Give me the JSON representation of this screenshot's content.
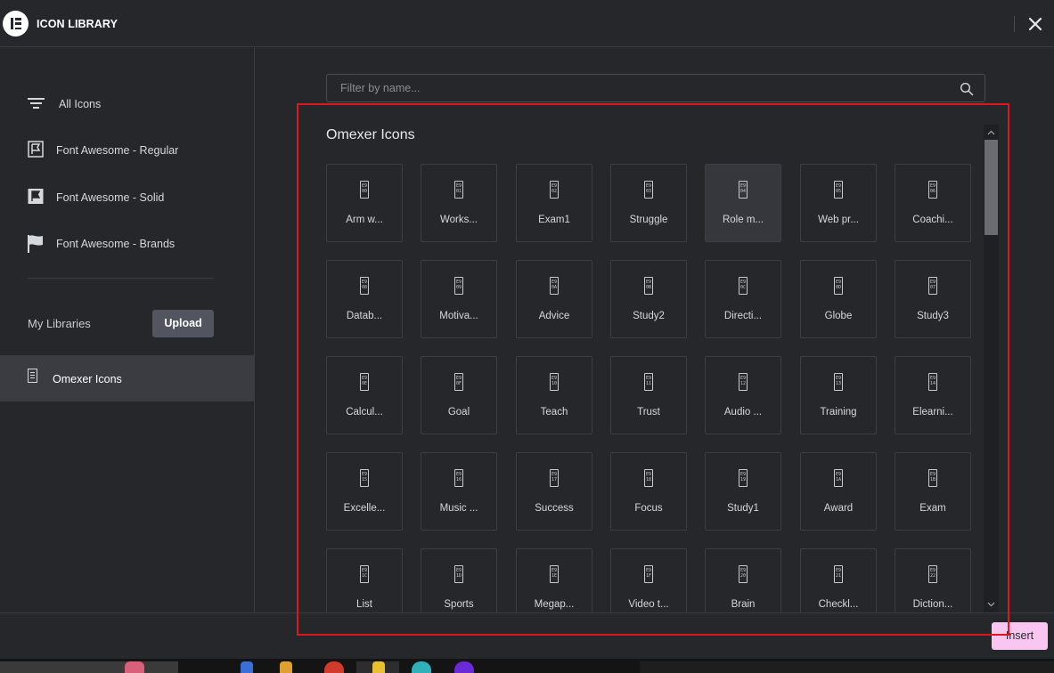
{
  "header": {
    "title": "ICON LIBRARY"
  },
  "sidebar": {
    "items": [
      {
        "label": "All Icons",
        "icon": "lines-icon"
      },
      {
        "label": "Font Awesome - Regular",
        "icon": "flag-regular-icon"
      },
      {
        "label": "Font Awesome - Solid",
        "icon": "flag-solid-icon"
      },
      {
        "label": "Font Awesome - Brands",
        "icon": "flag-brands-icon"
      }
    ],
    "my_libraries_label": "My Libraries",
    "upload_label": "Upload",
    "library": {
      "label": "Omexer Icons",
      "icon": "omexer-icon"
    }
  },
  "search": {
    "placeholder": "Filter by name..."
  },
  "section_title": "Omexer Icons",
  "icons": [
    {
      "label": "Arm w...",
      "code": "E9\n00"
    },
    {
      "label": "Works...",
      "code": "E9\n01"
    },
    {
      "label": "Exam1",
      "code": "E9\n02"
    },
    {
      "label": "Struggle",
      "code": "E9\n03"
    },
    {
      "label": "Role m...",
      "code": "E9\n04"
    },
    {
      "label": "Web pr...",
      "code": "E9\n05"
    },
    {
      "label": "Coachi...",
      "code": "E9\n06"
    },
    {
      "label": "Datab...",
      "code": "E9\n08"
    },
    {
      "label": "Motiva...",
      "code": "E9\n09"
    },
    {
      "label": "Advice",
      "code": "E9\n0A"
    },
    {
      "label": "Study2",
      "code": "E9\n0B"
    },
    {
      "label": "Directi...",
      "code": "E9\n0C"
    },
    {
      "label": "Globe",
      "code": "E9\n0D"
    },
    {
      "label": "Study3",
      "code": "E9\n07"
    },
    {
      "label": "Calcul...",
      "code": "E9\n0E"
    },
    {
      "label": "Goal",
      "code": "E9\n0F"
    },
    {
      "label": "Teach",
      "code": "E9\n10"
    },
    {
      "label": "Trust",
      "code": "E9\n11"
    },
    {
      "label": "Audio ...",
      "code": "E9\n12"
    },
    {
      "label": "Training",
      "code": "E9\n13"
    },
    {
      "label": "Elearni...",
      "code": "E9\n14"
    },
    {
      "label": "Excelle...",
      "code": "E9\n15"
    },
    {
      "label": "Music ...",
      "code": "E9\n16"
    },
    {
      "label": "Success",
      "code": "E9\n17"
    },
    {
      "label": "Focus",
      "code": "E9\n18"
    },
    {
      "label": "Study1",
      "code": "E9\n19"
    },
    {
      "label": "Award",
      "code": "E9\n1A"
    },
    {
      "label": "Exam",
      "code": "E9\n1B"
    },
    {
      "label": "List",
      "code": "E9\n1C"
    },
    {
      "label": "Sports",
      "code": "E9\n1D"
    },
    {
      "label": "Megap...",
      "code": "E9\n1E"
    },
    {
      "label": "Video t...",
      "code": "E9\n1F"
    },
    {
      "label": "Brain",
      "code": "E9\n20"
    },
    {
      "label": "Checkl...",
      "code": "E9\n21"
    },
    {
      "label": "Diction...",
      "code": "E9\n22"
    }
  ],
  "footer": {
    "insert_label": "Insert"
  },
  "colors": {
    "background": "#26272b",
    "highlight": "#e0161f",
    "insert_button": "#f8c6f0",
    "upload_button": "#525560"
  }
}
